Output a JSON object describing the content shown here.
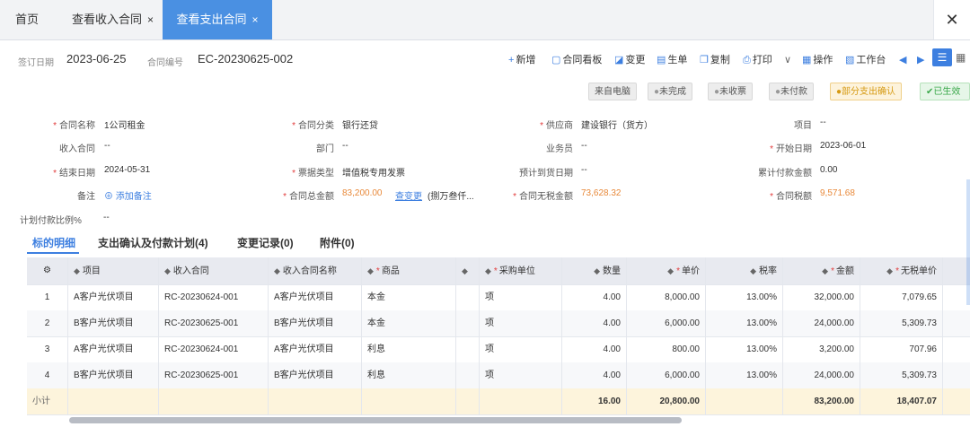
{
  "tabs": [
    {
      "label": "首页",
      "closable": false,
      "active": false
    },
    {
      "label": "查看收入合同",
      "closable": true,
      "active": false
    },
    {
      "label": "查看支出合同",
      "closable": true,
      "active": true
    }
  ],
  "tab_close_glyph": "×",
  "window_close_glyph": "✕",
  "header": {
    "sign_date_label": "签订日期",
    "sign_date": "2023-06-25",
    "contract_no_label": "合同编号",
    "contract_no": "EC-20230625-002"
  },
  "toolbar": [
    {
      "icon": "plus-icon",
      "glyph": "+",
      "label": "新增"
    },
    {
      "icon": "contract-view-icon",
      "glyph": "▢",
      "label": "合同看板"
    },
    {
      "icon": "change-icon",
      "glyph": "◪",
      "label": "变更"
    },
    {
      "icon": "generate-doc-icon",
      "glyph": "▤",
      "label": "生单"
    },
    {
      "icon": "copy-icon",
      "glyph": "❐",
      "label": "复制"
    },
    {
      "icon": "print-icon",
      "glyph": "⎙",
      "label": "打印"
    },
    {
      "icon": "chevron-down-icon",
      "glyph": "∨",
      "label": ""
    },
    {
      "icon": "operate-icon",
      "glyph": "▦",
      "label": "操作"
    },
    {
      "icon": "workbench-icon",
      "glyph": "▧",
      "label": "工作台"
    }
  ],
  "nav": {
    "prev": "◀",
    "next": "▶",
    "list": "☰",
    "grid": "▦"
  },
  "status_badges": [
    {
      "label": "来自电脑",
      "style": "plain",
      "icon": ""
    },
    {
      "label": "未完成",
      "style": "plain",
      "icon": "●"
    },
    {
      "label": "未收票",
      "style": "plain",
      "icon": "●"
    },
    {
      "label": "未付款",
      "style": "plain",
      "icon": "●"
    },
    {
      "label": "部分支出确认",
      "style": "warn",
      "icon": "●"
    },
    {
      "label": "已生效",
      "style": "ok",
      "icon": "✔"
    }
  ],
  "form": {
    "contract_name": {
      "label": "合同名称",
      "value": "1公司租金",
      "required": true
    },
    "contract_type": {
      "label": "合同分类",
      "value": "银行还贷",
      "required": true
    },
    "supplier": {
      "label": "供应商",
      "value": "建设银行（货方）",
      "required": true
    },
    "project": {
      "label": "项目",
      "value": "--",
      "required": false
    },
    "income_contract": {
      "label": "收入合同",
      "value": "--",
      "required": false
    },
    "department": {
      "label": "部门",
      "value": "--",
      "required": false
    },
    "salesperson": {
      "label": "业务员",
      "value": "--",
      "required": false
    },
    "start_date": {
      "label": "开始日期",
      "value": "2023-06-01",
      "required": true
    },
    "end_date": {
      "label": "结束日期",
      "value": "2024-05-31",
      "required": true
    },
    "invoice_type": {
      "label": "票据类型",
      "value": "增值税专用发票",
      "required": true
    },
    "expected_arrival": {
      "label": "预计到货日期",
      "value": "--",
      "required": false
    },
    "paid_total": {
      "label": "累计付款金额",
      "value": "0.00",
      "required": false
    },
    "remark": {
      "label": "备注",
      "value": "添加备注",
      "required": false
    },
    "total_amount": {
      "label": "合同总金额",
      "value": "83,200.00",
      "link": "查变更",
      "extra": "(捌万叁仟...",
      "required": true
    },
    "amount_ex_tax": {
      "label": "合同无税金额",
      "value": "73,628.32",
      "required": true
    },
    "tax_amount": {
      "label": "合同税额",
      "value": "9,571.68",
      "required": true
    },
    "plan_ratio": {
      "label": "计划付款比例%",
      "value": "--",
      "required": false
    }
  },
  "sub_tabs": [
    {
      "label": "标的明细",
      "active": true
    },
    {
      "label": "支出确认及付款计划(4)",
      "active": false
    },
    {
      "label": "变更记录(0)",
      "active": false
    },
    {
      "label": "附件(0)",
      "active": false
    }
  ],
  "table": {
    "columns": [
      {
        "key": "seq",
        "label": "⚙",
        "sort": false,
        "required": false
      },
      {
        "key": "project",
        "label": "项目",
        "sort": true,
        "required": false
      },
      {
        "key": "income_contract",
        "label": "收入合同",
        "sort": true,
        "required": false
      },
      {
        "key": "income_contract_name",
        "label": "收入合同名称",
        "sort": true,
        "required": false
      },
      {
        "key": "goods",
        "label": "商品",
        "sort": true,
        "required": true
      },
      {
        "key": "spec",
        "label": "",
        "sort": true,
        "required": false
      },
      {
        "key": "unit",
        "label": "采购单位",
        "sort": true,
        "required": true
      },
      {
        "key": "qty",
        "label": "数量",
        "sort": true,
        "required": false
      },
      {
        "key": "price",
        "label": "单价",
        "sort": true,
        "required": true
      },
      {
        "key": "tax_rate",
        "label": "税率",
        "sort": true,
        "required": false
      },
      {
        "key": "amount",
        "label": "金额",
        "sort": true,
        "required": true
      },
      {
        "key": "price_ex_tax",
        "label": "无税单价",
        "sort": true,
        "required": true
      }
    ],
    "rows": [
      {
        "seq": "1",
        "project": "A客户光伏项目",
        "income_contract": "RC-20230624-001",
        "income_contract_name": "A客户光伏项目",
        "goods": "本金",
        "spec": "",
        "unit": "项",
        "qty": "4.00",
        "price": "8,000.00",
        "tax_rate": "13.00%",
        "amount": "32,000.00",
        "price_ex_tax": "7,079.65"
      },
      {
        "seq": "2",
        "project": "B客户光伏项目",
        "income_contract": "RC-20230625-001",
        "income_contract_name": "B客户光伏项目",
        "goods": "本金",
        "spec": "",
        "unit": "项",
        "qty": "4.00",
        "price": "6,000.00",
        "tax_rate": "13.00%",
        "amount": "24,000.00",
        "price_ex_tax": "5,309.73"
      },
      {
        "seq": "3",
        "project": "A客户光伏项目",
        "income_contract": "RC-20230624-001",
        "income_contract_name": "A客户光伏项目",
        "goods": "利息",
        "spec": "",
        "unit": "项",
        "qty": "4.00",
        "price": "800.00",
        "tax_rate": "13.00%",
        "amount": "3,200.00",
        "price_ex_tax": "707.96"
      },
      {
        "seq": "4",
        "project": "B客户光伏项目",
        "income_contract": "RC-20230625-001",
        "income_contract_name": "B客户光伏项目",
        "goods": "利息",
        "spec": "",
        "unit": "项",
        "qty": "4.00",
        "price": "6,000.00",
        "tax_rate": "13.00%",
        "amount": "24,000.00",
        "price_ex_tax": "5,309.73"
      }
    ],
    "total": {
      "label": "小计",
      "qty": "16.00",
      "price": "20,800.00",
      "amount": "83,200.00",
      "price_ex_tax": "18,407.07"
    }
  }
}
